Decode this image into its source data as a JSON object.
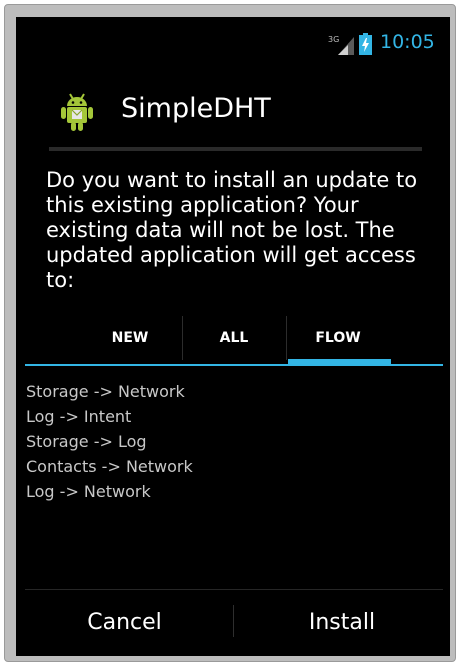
{
  "status_bar": {
    "network_label": "3G",
    "time": "10:05"
  },
  "dialog": {
    "app_name": "SimpleDHT",
    "message": "Do you want to install an update to this existing application? Your existing data will not be lost. The updated application will get access to:",
    "tabs": [
      {
        "label": "NEW",
        "selected": false
      },
      {
        "label": "ALL",
        "selected": false
      },
      {
        "label": "FLOW",
        "selected": true
      }
    ],
    "flows": [
      "Storage -> Network",
      "Log -> Intent",
      "Storage -> Log",
      "Contacts -> Network",
      "Log -> Network"
    ],
    "buttons": {
      "cancel": "Cancel",
      "install": "Install"
    }
  },
  "colors": {
    "accent": "#33b5e5",
    "background": "#000000",
    "text": "#ffffff",
    "android_green": "#a4c639"
  },
  "icons": [
    "network-signal-icon",
    "battery-icon",
    "android-app-icon"
  ]
}
